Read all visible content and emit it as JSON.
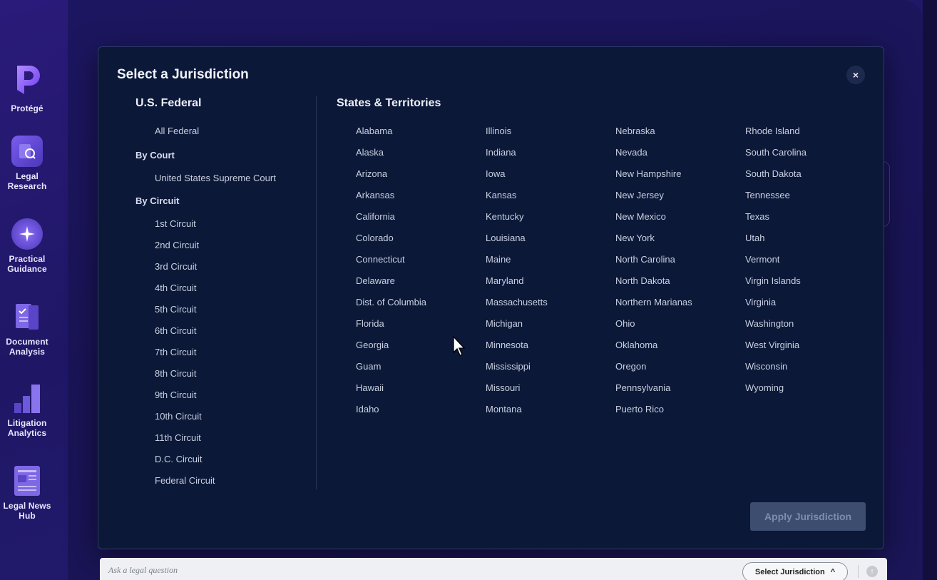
{
  "sidebar": {
    "items": [
      {
        "label": "Protégé",
        "icon": "protege-logo-icon"
      },
      {
        "label": "Legal Research",
        "icon": "legal-research-icon"
      },
      {
        "label": "Practical Guidance",
        "icon": "practical-guidance-icon"
      },
      {
        "label": "Document Analysis",
        "icon": "document-analysis-icon"
      },
      {
        "label": "Litigation Analytics",
        "icon": "litigation-analytics-icon"
      },
      {
        "label": "Legal News Hub",
        "icon": "legal-news-hub-icon"
      }
    ]
  },
  "modal": {
    "title": "Select a Jurisdiction",
    "close_label": "×",
    "federal": {
      "heading": "U.S. Federal",
      "all_label": "All Federal",
      "by_court_label": "By Court",
      "courts": [
        "United States Supreme Court"
      ],
      "by_circuit_label": "By Circuit",
      "circuits": [
        "1st Circuit",
        "2nd Circuit",
        "3rd Circuit",
        "4th Circuit",
        "5th Circuit",
        "6th Circuit",
        "7th Circuit",
        "8th Circuit",
        "9th Circuit",
        "10th Circuit",
        "11th Circuit",
        "D.C. Circuit",
        "Federal Circuit"
      ]
    },
    "states": {
      "heading": "States & Territories",
      "columns": [
        [
          "Alabama",
          "Alaska",
          "Arizona",
          "Arkansas",
          "California",
          "Colorado",
          "Connecticut",
          "Delaware",
          "Dist. of Columbia",
          "Florida",
          "Georgia",
          "Guam",
          "Hawaii",
          "Idaho"
        ],
        [
          "Illinois",
          "Indiana",
          "Iowa",
          "Kansas",
          "Kentucky",
          "Louisiana",
          "Maine",
          "Maryland",
          "Massachusetts",
          "Michigan",
          "Minnesota",
          "Mississippi",
          "Missouri",
          "Montana"
        ],
        [
          "Nebraska",
          "Nevada",
          "New Hampshire",
          "New Jersey",
          "New Mexico",
          "New York",
          "North Carolina",
          "North Dakota",
          "Northern Marianas",
          "Ohio",
          "Oklahoma",
          "Oregon",
          "Pennsylvania",
          "Puerto Rico"
        ],
        [
          "Rhode Island",
          "South Carolina",
          "South Dakota",
          "Tennessee",
          "Texas",
          "Utah",
          "Vermont",
          "Virgin Islands",
          "Virginia",
          "Washington",
          "West Virginia",
          "Wisconsin",
          "Wyoming"
        ]
      ]
    },
    "apply_label": "Apply Jurisdiction"
  },
  "bottom_bar": {
    "placeholder": "Ask a legal question",
    "jurisdiction_button": "Select Jurisdiction",
    "chevron": "^"
  },
  "colors": {
    "modal_bg": "#0b1838",
    "accent": "#5b3fd6",
    "apply_disabled": "#3c4d70"
  }
}
